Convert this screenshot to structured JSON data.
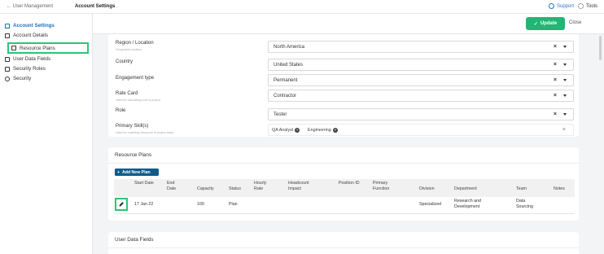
{
  "breadcrumb": {
    "back": "User Management",
    "current": "Account Settings"
  },
  "topbar": {
    "support": "Support",
    "tools": "Tools"
  },
  "sidebar": {
    "items": [
      {
        "label": "Account Settings",
        "icon": "home-icon",
        "active": true
      },
      {
        "label": "Account Details",
        "icon": "document-icon"
      },
      {
        "label": "Resource Plans",
        "icon": "document-icon",
        "highlighted": true
      },
      {
        "label": "User Data Fields",
        "icon": "list-icon"
      },
      {
        "label": "Security Roles",
        "icon": "id-card-icon"
      },
      {
        "label": "Security",
        "icon": "users-icon"
      }
    ]
  },
  "header": {
    "update_label": "Update",
    "close_label": "Close"
  },
  "form": {
    "fields": [
      {
        "label": "Region / Location",
        "hint": "Geographic location",
        "value": "North America"
      },
      {
        "label": "Country",
        "hint": "",
        "value": "United States"
      },
      {
        "label": "Engagement type",
        "hint": "",
        "value": "Permanent"
      },
      {
        "label": "Rate Card",
        "hint": "Used for calculating cost to project",
        "value": "Contractor"
      },
      {
        "label": "Role",
        "hint": "",
        "value": "Tester"
      }
    ],
    "skills": {
      "label": "Primary Skill(s)",
      "hint": "Used for matching resources to project tasks",
      "chips": [
        "QA Analyst",
        "Engineering"
      ]
    }
  },
  "resource_plans": {
    "title": "Resource Plans",
    "add_button": "Add New Plan",
    "columns": [
      "Start Date",
      "End Date",
      "Capacity",
      "Status",
      "Hourly Rate",
      "Headcount Impact",
      "Position ID",
      "Primary Function",
      "Division",
      "Department",
      "Team",
      "Notes"
    ],
    "rows": [
      {
        "start_date": "17 Jan 22",
        "end_date": "",
        "capacity": "100",
        "status": "Plan",
        "hourly_rate": "",
        "headcount_impact": "",
        "position_id": "",
        "primary_function": "",
        "division": "Specialized",
        "department": "Research and Development",
        "team": "Data Sourcing",
        "notes": ""
      }
    ]
  },
  "user_data_fields": {
    "title": "User Data Fields"
  },
  "colors": {
    "accent": "#1c6fc2",
    "update_green": "#22b573",
    "highlight_green": "#2ec471",
    "add_button": "#0f5b8a"
  }
}
